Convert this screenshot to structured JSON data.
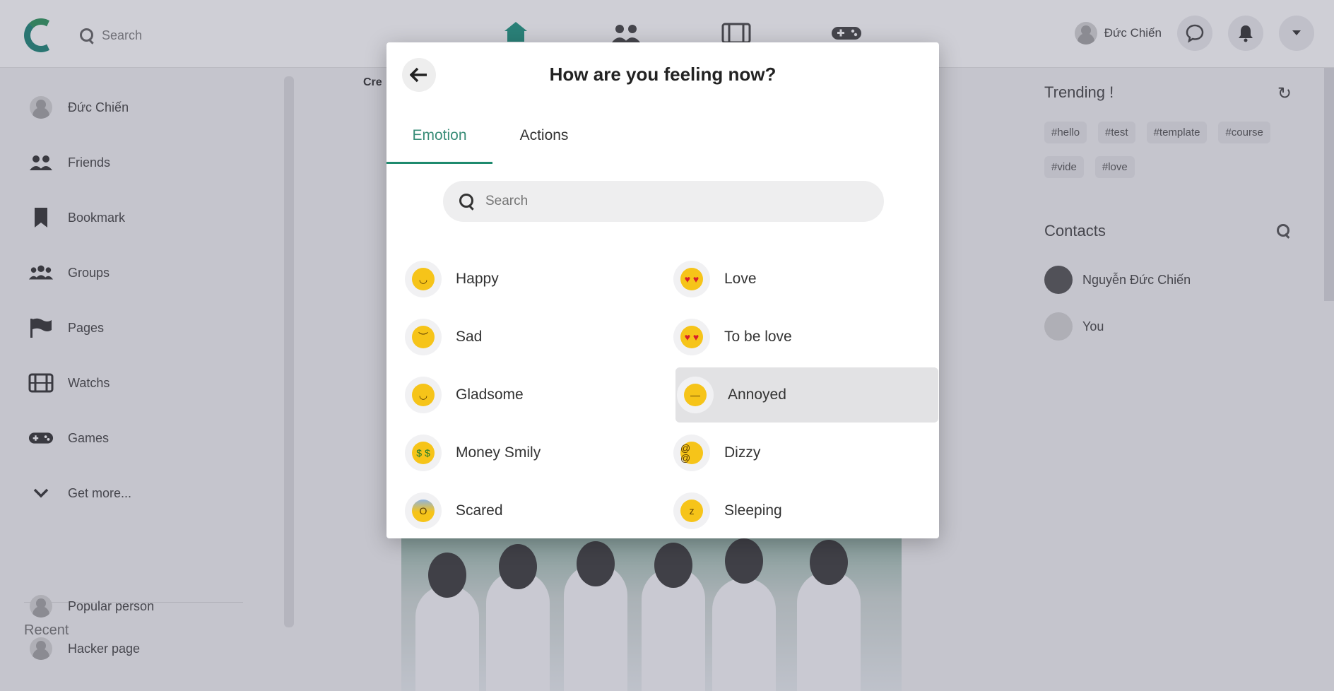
{
  "topbar": {
    "search_placeholder": "Search",
    "user_name": "Đức Chiến",
    "nav_icons": [
      "home-icon",
      "friends-icon",
      "watch-icon",
      "games-icon"
    ]
  },
  "sidebar": {
    "items": [
      {
        "label": "Đức Chiến",
        "icon": "avatar"
      },
      {
        "label": "Friends",
        "icon": "friends-icon"
      },
      {
        "label": "Bookmark",
        "icon": "bookmark-icon"
      },
      {
        "label": "Groups",
        "icon": "groups-icon"
      },
      {
        "label": "Pages",
        "icon": "flag-icon"
      },
      {
        "label": "Watchs",
        "icon": "film-icon"
      },
      {
        "label": "Games",
        "icon": "gamepad-icon"
      },
      {
        "label": "Get more...",
        "icon": "chevron-down-icon"
      }
    ],
    "recent_title": "Recent",
    "recent_items": [
      "Popular person",
      "Hacker page"
    ]
  },
  "feed": {
    "create_label": "Cre"
  },
  "right": {
    "trending_title": "Trending !",
    "tags": [
      "#hello",
      "#test",
      "#template",
      "#course",
      "#vide",
      "#love"
    ],
    "contacts_title": "Contacts",
    "contacts": [
      "Nguyễn Đức Chiến",
      "You"
    ]
  },
  "modal": {
    "title": "How are you feeling now?",
    "tabs": {
      "emotion": "Emotion",
      "actions": "Actions"
    },
    "search_placeholder": "Search",
    "emotions": [
      {
        "label": "Happy",
        "face": "◡"
      },
      {
        "label": "Love",
        "face": "♥ ♥"
      },
      {
        "label": "Sad",
        "face": "︶"
      },
      {
        "label": "To be love",
        "face": "♥ ♥"
      },
      {
        "label": "Gladsome",
        "face": "◡"
      },
      {
        "label": "Annoyed",
        "face": "—"
      },
      {
        "label": "Money Smily",
        "face": "$ $"
      },
      {
        "label": "Dizzy",
        "face": "@ @"
      },
      {
        "label": "Scared",
        "face": "O"
      },
      {
        "label": "Sleeping",
        "face": "z"
      }
    ],
    "selected": "Annoyed"
  },
  "colors": {
    "accent": "#1e8a6e",
    "emoji_yellow": "#f6c419"
  }
}
